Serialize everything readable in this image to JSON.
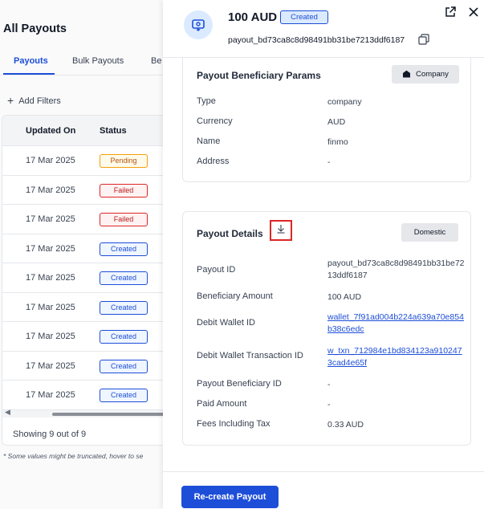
{
  "background_page": {
    "title": "All Payouts",
    "tabs": [
      {
        "label": "Payouts",
        "active": true
      },
      {
        "label": "Bulk Payouts",
        "active": false
      },
      {
        "label": "Be",
        "active": false
      }
    ],
    "add_filters": "Add Filters",
    "table": {
      "columns": [
        "Updated On",
        "Status"
      ],
      "rows": [
        {
          "date": "17 Mar 2025",
          "status": "Pending"
        },
        {
          "date": "17 Mar 2025",
          "status": "Failed"
        },
        {
          "date": "17 Mar 2025",
          "status": "Failed"
        },
        {
          "date": "17 Mar 2025",
          "status": "Created"
        },
        {
          "date": "17 Mar 2025",
          "status": "Created"
        },
        {
          "date": "17 Mar 2025",
          "status": "Created"
        },
        {
          "date": "17 Mar 2025",
          "status": "Created"
        },
        {
          "date": "17 Mar 2025",
          "status": "Created"
        },
        {
          "date": "17 Mar 2025",
          "status": "Created"
        }
      ]
    },
    "showing": "Showing 9 out of 9",
    "footnote": "* Some values might be truncated, hover to se"
  },
  "drawer": {
    "amount": "100 AUD",
    "status": "Created",
    "payout_id": "payout_bd73ca8c8d98491bb31be7213ddf6187",
    "beneficiary_card": {
      "title": "Payout Beneficiary Params",
      "chip": "Company",
      "fields": [
        {
          "label": "Type",
          "value": "company"
        },
        {
          "label": "Currency",
          "value": "AUD"
        },
        {
          "label": "Name",
          "value": "finmo"
        },
        {
          "label": "Address",
          "value": "-"
        }
      ]
    },
    "details_card": {
      "title": "Payout Details",
      "chip": "Domestic",
      "fields": [
        {
          "label": "Payout ID",
          "value": "payout_bd73ca8c8d98491bb31be7213ddf6187",
          "link": false
        },
        {
          "label": "Beneficiary Amount",
          "value": "100 AUD",
          "link": false
        },
        {
          "label": "Debit Wallet ID",
          "value": "wallet_7f91ad004b224a639a70e854b38c6edc",
          "link": true
        },
        {
          "label": "Debit Wallet Transaction ID",
          "value": "w_txn_712984e1bd834123a9102473cad4e65f",
          "link": true
        },
        {
          "label": "Payout Beneficiary ID",
          "value": "-",
          "link": false
        },
        {
          "label": "Paid Amount",
          "value": "-",
          "link": false
        },
        {
          "label": "Fees Including Tax",
          "value": "0.33 AUD",
          "link": false
        }
      ]
    },
    "footer": {
      "recreate_label": "Re-create Payout"
    }
  },
  "colors": {
    "accent": "#1d4ed8",
    "pending": "#f59e0b",
    "failed": "#dc2626",
    "highlight_box": "#dc2626"
  },
  "icons": [
    "payout-icon",
    "copy-icon",
    "external-link-icon",
    "close-icon",
    "building-icon",
    "download-icon",
    "plus-icon"
  ]
}
